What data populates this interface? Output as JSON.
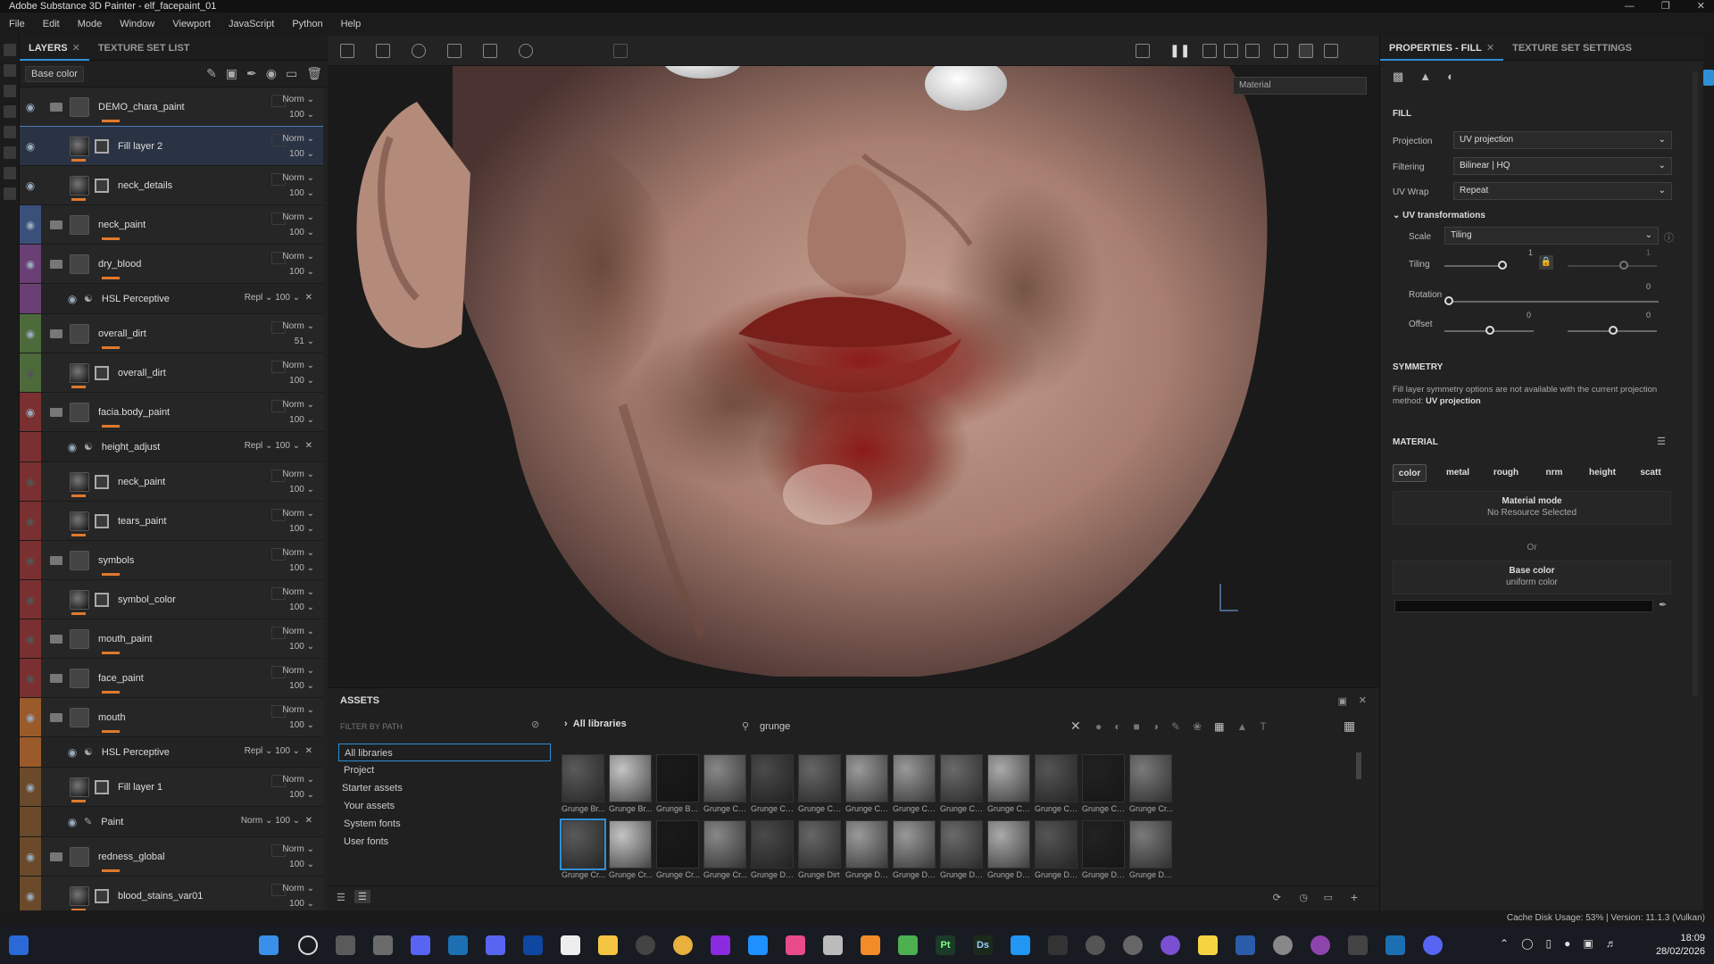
{
  "window": {
    "title": "Adobe Substance 3D Painter - elf_facepaint_01"
  },
  "menu": [
    "File",
    "Edit",
    "Mode",
    "Window",
    "Viewport",
    "JavaScript",
    "Python",
    "Help"
  ],
  "layers_panel": {
    "tabs": [
      "LAYERS",
      "TEXTURE SET LIST"
    ],
    "channel_select": "Base color",
    "layers": [
      {
        "name": "DEMO_chara_paint",
        "blend": "Norm",
        "opacity": "100",
        "kind": "folder",
        "color": "",
        "eye": true
      },
      {
        "name": "Fill layer 2",
        "blend": "Norm",
        "opacity": "100",
        "kind": "fill",
        "color": "",
        "eye": true,
        "selected": true
      },
      {
        "name": "neck_details",
        "blend": "Norm",
        "opacity": "100",
        "kind": "fill",
        "color": "",
        "eye": true
      },
      {
        "name": "neck_paint",
        "blend": "Norm",
        "opacity": "100",
        "kind": "folder",
        "color": "#3a4f7a",
        "eye": true
      },
      {
        "name": "dry_blood",
        "blend": "Norm",
        "opacity": "100",
        "kind": "folder",
        "color": "#6a3f73",
        "eye": true
      },
      {
        "name": "HSL Perceptive",
        "blend": "Repl",
        "opacity": "100",
        "kind": "effect",
        "color": "#6a3f73"
      },
      {
        "name": "overall_dirt",
        "blend": "Norm",
        "opacity": "51",
        "kind": "folder",
        "color": "#4d6a3a",
        "eye": true
      },
      {
        "name": "overall_dirt",
        "blend": "Norm",
        "opacity": "100",
        "kind": "fill",
        "color": "#4d6a3a",
        "eye": false
      },
      {
        "name": "facia.body_paint",
        "blend": "Norm",
        "opacity": "100",
        "kind": "folder",
        "color": "#7a3030",
        "eye": true
      },
      {
        "name": "height_adjust",
        "blend": "Repl",
        "opacity": "100",
        "kind": "effect",
        "color": "#7a3030"
      },
      {
        "name": "neck_paint",
        "blend": "Norm",
        "opacity": "100",
        "kind": "fill",
        "color": "#7a3030",
        "eye": false
      },
      {
        "name": "tears_paint",
        "blend": "Norm",
        "opacity": "100",
        "kind": "fill",
        "color": "#7a3030",
        "eye": false
      },
      {
        "name": "symbols",
        "blend": "Norm",
        "opacity": "100",
        "kind": "folder",
        "color": "#7a3030",
        "eye": false
      },
      {
        "name": "symbol_color",
        "blend": "Norm",
        "opacity": "100",
        "kind": "fill",
        "color": "#7a3030",
        "eye": false
      },
      {
        "name": "mouth_paint",
        "blend": "Norm",
        "opacity": "100",
        "kind": "folder",
        "color": "#7a3030",
        "eye": false
      },
      {
        "name": "face_paint",
        "blend": "Norm",
        "opacity": "100",
        "kind": "folder",
        "color": "#7a3030",
        "eye": false
      },
      {
        "name": "mouth",
        "blend": "Norm",
        "opacity": "100",
        "kind": "folder",
        "color": "#9a5a2a",
        "eye": true
      },
      {
        "name": "HSL Perceptive",
        "blend": "Repl",
        "opacity": "100",
        "kind": "effect",
        "color": "#9a5a2a"
      },
      {
        "name": "Fill layer 1",
        "blend": "Norm",
        "opacity": "100",
        "kind": "fill",
        "color": "#6a4a2a",
        "eye": true
      },
      {
        "name": "Paint",
        "blend": "Norm",
        "opacity": "100",
        "kind": "effect",
        "color": "#6a4a2a"
      },
      {
        "name": "redness_global",
        "blend": "Norm",
        "opacity": "100",
        "kind": "folder",
        "color": "#6a4a2a",
        "eye": true
      },
      {
        "name": "blood_stains_var01",
        "blend": "Norm",
        "opacity": "100",
        "kind": "fill",
        "color": "#6a4a2a",
        "eye": true
      }
    ]
  },
  "viewport": {
    "material_select": "Material"
  },
  "assets": {
    "title": "ASSETS",
    "filter_label": "FILTER BY PATH",
    "breadcrumb": "All libraries",
    "search": "grunge",
    "libraries": [
      "All libraries",
      "Project",
      "Starter assets",
      "Your assets",
      "System fonts",
      "User fonts"
    ],
    "tiles": [
      "Grunge Br...",
      "Grunge Br...",
      "Grunge Bu...",
      "Grunge Ch...",
      "Grunge Co...",
      "Grunge Co...",
      "Grunge Co...",
      "Grunge Co...",
      "Grunge Co...",
      "Grunge Co...",
      "Grunge Co...",
      "Grunge Co...",
      "Grunge Cr...",
      "Grunge Cr...",
      "Grunge Cr...",
      "Grunge Cr...",
      "Grunge Cr...",
      "Grunge Da...",
      "Grunge Dirt",
      "Grunge Dir...",
      "Grunge Dir...",
      "Grunge Dir...",
      "Grunge Dir...",
      "Grunge Dir...",
      "Grunge Dir...",
      "Grunge Dir..."
    ]
  },
  "properties": {
    "tabs": [
      "PROPERTIES - FILL",
      "TEXTURE SET SETTINGS"
    ],
    "fill_heading": "FILL",
    "projection_label": "Projection",
    "projection": "UV projection",
    "filtering_label": "Filtering",
    "filtering": "Bilinear | HQ",
    "uvwrap_label": "UV Wrap",
    "uvwrap": "Repeat",
    "uvt_heading": "UV transformations",
    "scale_label": "Scale",
    "scale": "Tiling",
    "tiling_label": "Tiling",
    "tiling_value": "1",
    "tiling_value2": "1",
    "rotation_label": "Rotation",
    "rotation_value": "0",
    "offset_label": "Offset",
    "offset_u": "0",
    "offset_v": "0",
    "symmetry_heading": "SYMMETRY",
    "symmetry_text": "Fill layer symmetry options are not available with the current projection method:",
    "symmetry_method": "UV projection",
    "material_heading": "MATERIAL",
    "channels": [
      "color",
      "metal",
      "rough",
      "nrm",
      "height",
      "scatt"
    ],
    "material_mode_title": "Material mode",
    "material_mode_sub": "No Resource Selected",
    "or_label": "Or",
    "base_color_title": "Base color",
    "base_color_sub": "uniform color"
  },
  "status": {
    "text": "Cache Disk Usage:   53% | Version: 11.1.3 (Vulkan)"
  },
  "taskbar": {
    "time": "18:09",
    "date": "28/02/2026"
  }
}
